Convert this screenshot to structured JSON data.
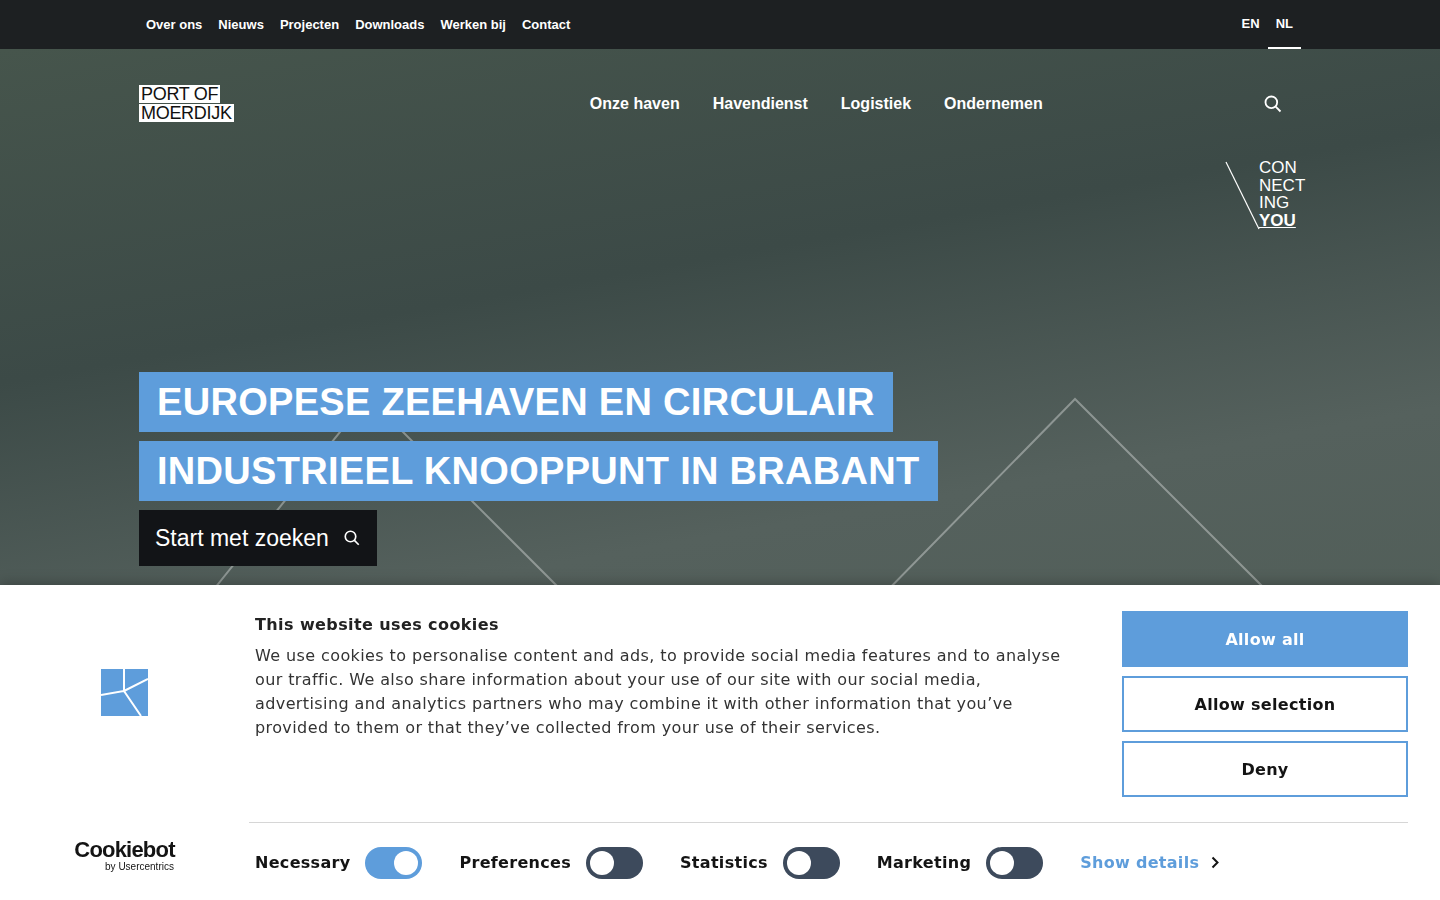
{
  "topbar": {
    "links": [
      "Over ons",
      "Nieuws",
      "Projecten",
      "Downloads",
      "Werken bij",
      "Contact"
    ],
    "languages": [
      {
        "label": "EN",
        "selected": false
      },
      {
        "label": "NL",
        "selected": true
      }
    ]
  },
  "header": {
    "logo": [
      "PORT OF",
      "MOERDIJK"
    ],
    "nav": [
      "Onze haven",
      "Havendienst",
      "Logistiek",
      "Ondernemen"
    ],
    "badge": [
      {
        "text": "CON",
        "bold": false
      },
      {
        "text": "NECT",
        "bold": false
      },
      {
        "text": "ING",
        "bold": false
      },
      {
        "text": "YOU",
        "bold": true
      }
    ]
  },
  "hero": {
    "headline": [
      "EUROPESE ZEEHAVEN EN CIRCULAIR",
      "INDUSTRIEEL KNOOPPUNT IN BRABANT"
    ],
    "button": "Start met zoeken"
  },
  "cookie_banner": {
    "brand": {
      "name": "Cookiebot",
      "byline": "by Usercentrics"
    },
    "title": "This website uses cookies",
    "text": "We use cookies to personalise content and ads, to provide social media features and to analyse our traffic. We also share information about your use of our site with our social media, advertising and analytics partners who may combine it with other information that you’ve provided to them or that they’ve collected from your use of their services.",
    "buttons": [
      {
        "label": "Allow all",
        "kind": "primary"
      },
      {
        "label": "Allow selection",
        "kind": "outline"
      },
      {
        "label": "Deny",
        "kind": "outline"
      }
    ],
    "toggles": [
      {
        "label": "Necessary",
        "on": true
      },
      {
        "label": "Preferences",
        "on": false
      },
      {
        "label": "Statistics",
        "on": false
      },
      {
        "label": "Marketing",
        "on": false
      }
    ],
    "details": "Show details"
  }
}
